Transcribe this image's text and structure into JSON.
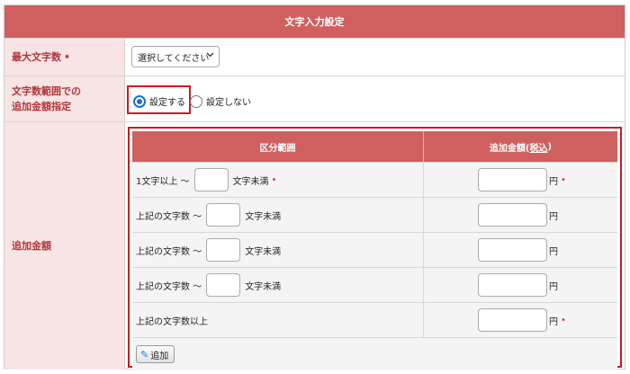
{
  "header": {
    "title": "文字入力設定"
  },
  "max_chars": {
    "label": "最大文字数",
    "required_mark": "•",
    "select_value": "選択してください",
    "chevron": "chevron-down-icon"
  },
  "range_setting": {
    "label_line1": "文字数範囲での",
    "label_line2": "追加金額指定",
    "options": [
      {
        "label": "設定する",
        "checked": true
      },
      {
        "label": "設定しない",
        "checked": false
      }
    ]
  },
  "extra_fee": {
    "label": "追加金額",
    "table": {
      "col1_header": "区分範囲",
      "col2_header_prefix": "追加金額(",
      "col2_header_link": "税込",
      "col2_header_suffix": ")",
      "rows": [
        {
          "prefix": "1文字以上 〜",
          "suffix": "文字未満",
          "required": "•",
          "unit": "円",
          "unit_required": "•"
        },
        {
          "prefix": "上記の文字数 〜",
          "suffix": "文字未満",
          "required": "",
          "unit": "円",
          "unit_required": ""
        },
        {
          "prefix": "上記の文字数 〜",
          "suffix": "文字未満",
          "required": "",
          "unit": "円",
          "unit_required": ""
        },
        {
          "prefix": "上記の文字数 〜",
          "suffix": "文字未満",
          "required": "",
          "unit": "円",
          "unit_required": ""
        },
        {
          "prefix": "上記の文字数以上",
          "suffix": "",
          "required": "",
          "unit": "円",
          "unit_required": "•"
        }
      ],
      "add_button": "追加"
    }
  },
  "colors": {
    "accent": "#d06060",
    "highlight": "#c41e23",
    "label_bg": "#f7e4e4",
    "label_text": "#b2353a"
  }
}
